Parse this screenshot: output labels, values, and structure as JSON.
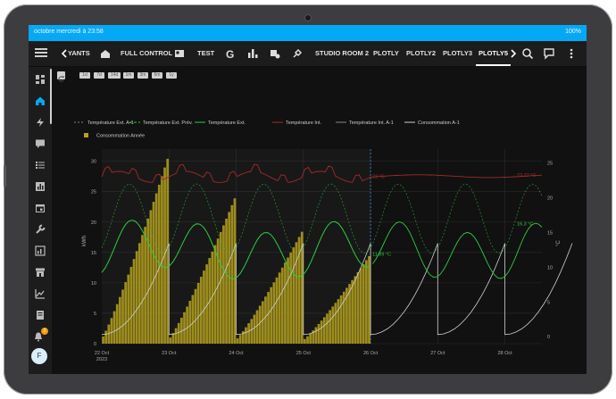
{
  "status_bar": {
    "left": "octobre mercredi à 23:58",
    "right": "100%"
  },
  "tabs": [
    "YANTS",
    "FULL CONTROL",
    "TEST",
    "STUDIO ROOM 2",
    "PLOTLY",
    "PLOTLY2",
    "PLOTLY3",
    "PLOTLY5"
  ],
  "active_tab": "PLOTLY5",
  "range_buttons": [
    "1d",
    "7d",
    "14d",
    "1m",
    "3m",
    "6m",
    "1y"
  ],
  "avatar_initial": "F",
  "notification_count": "2",
  "colors": {
    "accent": "#03a9f4",
    "bars": "#b5a21e",
    "series_green": "#2ecc40",
    "series_red": "#a52a2a",
    "series_white": "#cfcfcf",
    "series_gray": "#888888"
  },
  "chart_data": {
    "type": "line",
    "xlabel": "",
    "ylabel": "kWh",
    "y2label": "°C",
    "x_ticks": [
      "22 Oct\n2023",
      "23 Oct",
      "24 Oct",
      "25 Oct",
      "26 Oct",
      "27 Oct",
      "28 Oct"
    ],
    "ylim": [
      0,
      32
    ],
    "y_ticks": [
      0,
      5,
      10,
      15,
      20,
      25,
      30
    ],
    "y2lim": [
      -1,
      27
    ],
    "y2_ticks": [
      0,
      5,
      10,
      15,
      20,
      25
    ],
    "legend": [
      "Température Ext. A-1",
      "Température Ext. Prév.",
      "Température Ext.",
      "Température Int.",
      "Température Int. A-1",
      "Consommation A-1",
      "Consommation Année"
    ],
    "legend_position": "top",
    "annotations": {
      "temp_int": "23 °C",
      "temp_int_forecast": "23.27 °C",
      "temp_ext": "11.89 °C",
      "temp_ext_forecast": "16.3 °C"
    },
    "now": "26 Oct",
    "series": [
      {
        "name": "Consommation Année",
        "type": "bar",
        "x_start": "22 Oct",
        "x_end": "26 Oct",
        "daily_max": [
          30,
          23.5,
          18,
          14
        ]
      },
      {
        "name": "Température Int.",
        "type": "line",
        "min": 22,
        "max": 24.5
      },
      {
        "name": "Température Ext.",
        "type": "line",
        "min": 9,
        "max": 18
      },
      {
        "name": "Température Ext. Prév.",
        "type": "line",
        "min": 12,
        "max": 23
      }
    ]
  }
}
